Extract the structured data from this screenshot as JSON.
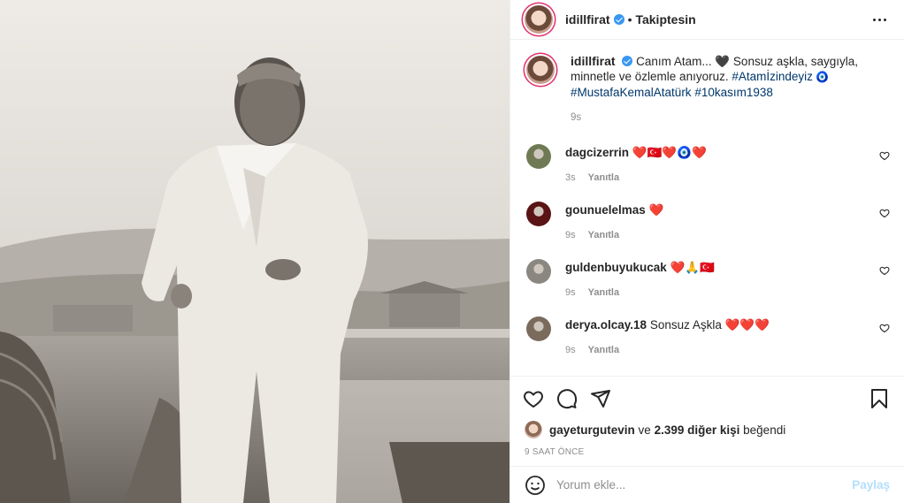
{
  "post": {
    "author": "idillfirat",
    "follow_state": "Takiptesin",
    "separator": "•",
    "caption": {
      "part1": "Canım Atam... 🖤 Sonsuz aşkla, saygıyla, minnetle ve özlemle anıyoruz.",
      "hashtag1": "#Atamİzindeyiz",
      "emoji": " 🧿 ",
      "hashtag2": "#MustafaKemalAtatürk",
      "hashtag3": "#10kasım1938",
      "time": "9s"
    },
    "comments": [
      {
        "user": "dagcizerrin",
        "text": "❤️🇹🇷❤️🧿❤️",
        "time": "3s",
        "reply": "Yanıtla",
        "avatar_color": "#6f7a55"
      },
      {
        "user": "gounuelelmas",
        "text": "❤️",
        "time": "9s",
        "reply": "Yanıtla",
        "avatar_color": "#5a1416"
      },
      {
        "user": "guldenbuyukucak",
        "text": "❤️🙏🇹🇷",
        "time": "9s",
        "reply": "Yanıtla",
        "avatar_color": "#8a8780"
      },
      {
        "user": "derya.olcay.18",
        "text": "Sonsuz Aşkla ❤️❤️❤️",
        "time": "9s",
        "reply": "Yanıtla",
        "avatar_color": "#7b6b5d"
      }
    ],
    "likes": {
      "first_user": "gayeturgutevin",
      "connector": "ve",
      "count_text": "2.399 diğer kişi",
      "suffix": "beğendi"
    },
    "time_ago": "9 SAAT ÖNCE",
    "comment_input": {
      "placeholder": "Yorum ekle..."
    },
    "share_label": "Paylaş"
  },
  "icons": {
    "more": "more-options-icon",
    "like": "heart-icon",
    "comment": "comment-icon",
    "share": "paper-plane-icon",
    "save": "bookmark-icon",
    "emoji": "smiley-icon",
    "verified": "verified-badge-icon"
  },
  "colors": {
    "link": "#00376b",
    "verified": "#3897f0",
    "muted": "#8e8e8e",
    "share_disabled": "#b2dffc"
  }
}
